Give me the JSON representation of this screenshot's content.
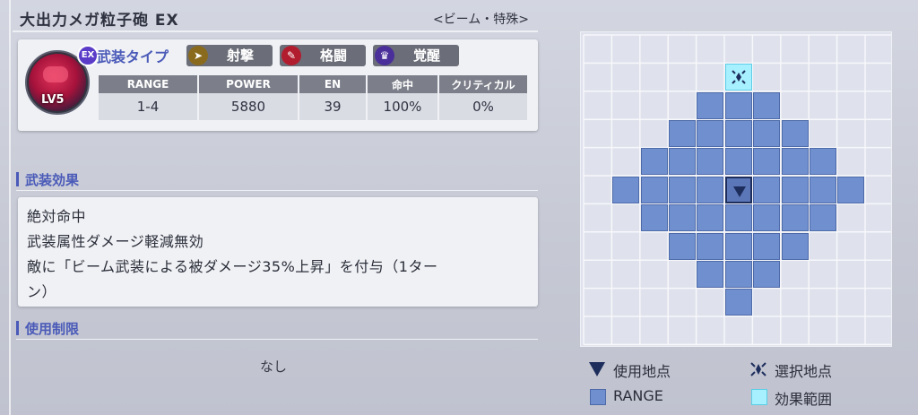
{
  "weapon": {
    "name": "大出力メガ粒子砲 EX",
    "category": "<ビーム・特殊>",
    "level": "LV5",
    "ex_badge": "EX",
    "type_label": "武装タイプ",
    "tags": [
      {
        "label": "射撃",
        "icon": "shooting-icon",
        "icon_glyph": "➤",
        "color": "#8a6b1e"
      },
      {
        "label": "格闘",
        "icon": "melee-icon",
        "icon_glyph": "✎",
        "color": "#b11d2e"
      },
      {
        "label": "覚醒",
        "icon": "awakening-icon",
        "icon_glyph": "♛",
        "color": "#4a2f9a"
      }
    ],
    "stats": {
      "headers": [
        "RANGE",
        "POWER",
        "EN",
        "命中",
        "クリティカル"
      ],
      "values": [
        "1-4",
        "5880",
        "39",
        "100%",
        "0%"
      ]
    }
  },
  "effects": {
    "heading": "武装効果",
    "lines": [
      "絶対命中",
      "武装属性ダメージ軽減無効",
      "敵に「ビーム武装による被ダメージ35%上昇」を付与（1ター",
      "ン）"
    ]
  },
  "restriction": {
    "heading": "使用制限",
    "value": "なし"
  },
  "range_map": {
    "cols": 11,
    "rows": 11,
    "effect_cells": [
      [
        5,
        1
      ]
    ],
    "user_cell": [
      5,
      5
    ],
    "range_cells": [
      [
        4,
        2
      ],
      [
        5,
        2
      ],
      [
        6,
        2
      ],
      [
        3,
        3
      ],
      [
        4,
        3
      ],
      [
        5,
        3
      ],
      [
        6,
        3
      ],
      [
        7,
        3
      ],
      [
        2,
        4
      ],
      [
        3,
        4
      ],
      [
        4,
        4
      ],
      [
        5,
        4
      ],
      [
        6,
        4
      ],
      [
        7,
        4
      ],
      [
        8,
        4
      ],
      [
        1,
        5
      ],
      [
        2,
        5
      ],
      [
        3,
        5
      ],
      [
        4,
        5
      ],
      [
        6,
        5
      ],
      [
        7,
        5
      ],
      [
        8,
        5
      ],
      [
        9,
        5
      ],
      [
        2,
        6
      ],
      [
        3,
        6
      ],
      [
        4,
        6
      ],
      [
        5,
        6
      ],
      [
        6,
        6
      ],
      [
        7,
        6
      ],
      [
        8,
        6
      ],
      [
        3,
        7
      ],
      [
        4,
        7
      ],
      [
        5,
        7
      ],
      [
        6,
        7
      ],
      [
        7,
        7
      ],
      [
        4,
        8
      ],
      [
        5,
        8
      ],
      [
        6,
        8
      ],
      [
        5,
        9
      ]
    ]
  },
  "legend": {
    "use_point": "使用地点",
    "select_point": "選択地点",
    "range": "RANGE",
    "effect_range": "効果範囲"
  },
  "colors": {
    "accent": "#4a5ab8",
    "range_cell": "#6f8fcf",
    "effect_cell": "#a6f0ff",
    "user_marker": "#1d2d5c"
  }
}
